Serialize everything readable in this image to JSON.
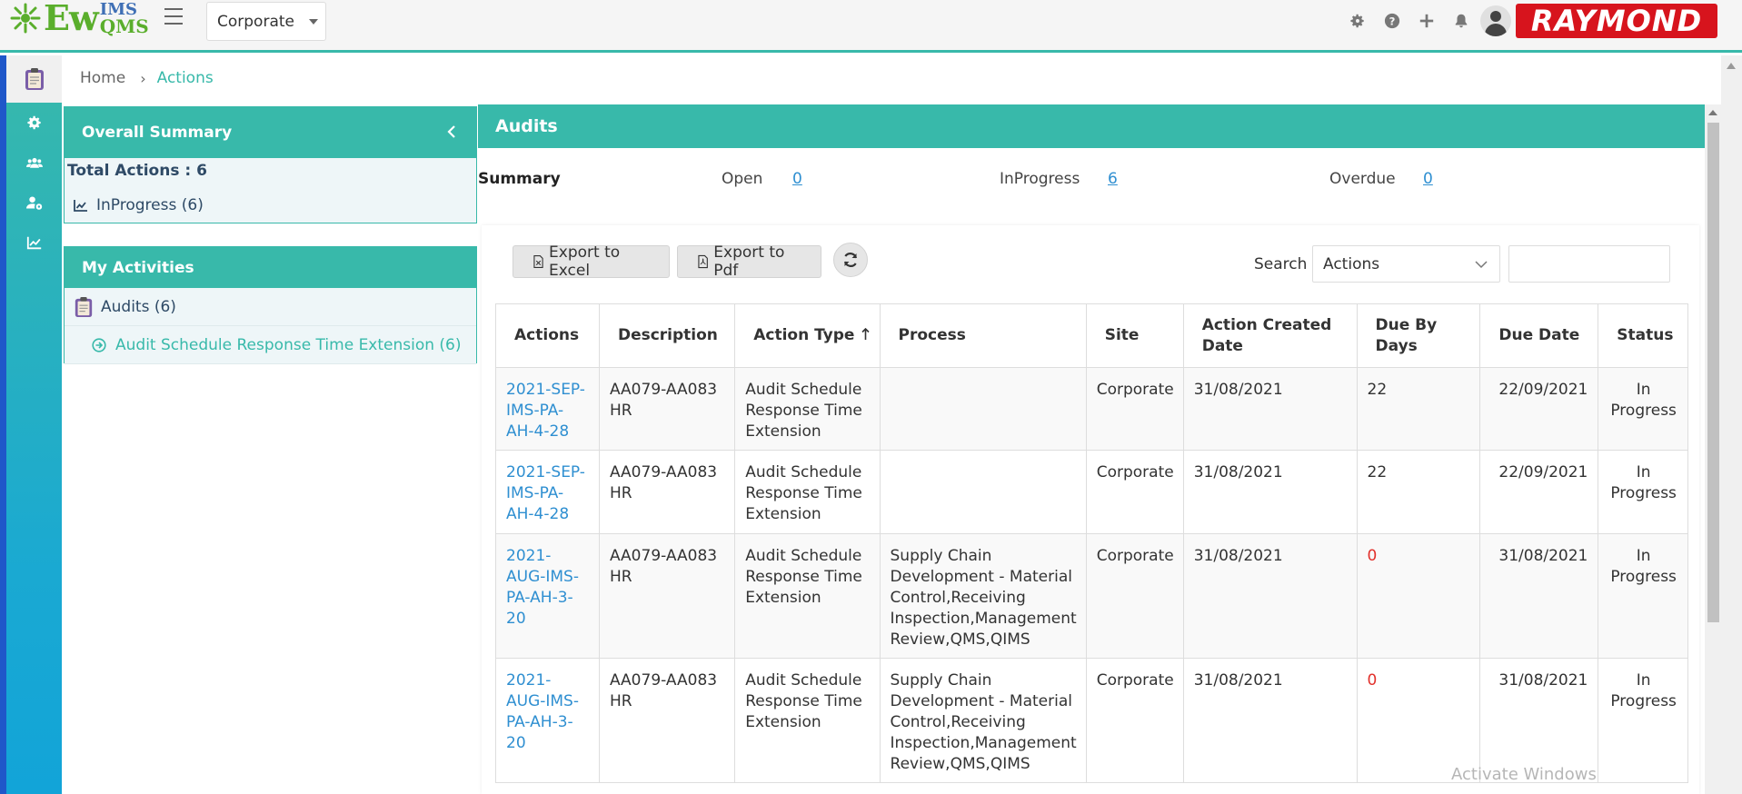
{
  "topbar": {
    "logo_ew": "Ew",
    "logo_ims": "IMS",
    "logo_qms": "QMS",
    "site_selected": "Corporate",
    "brand": "RAYMOND"
  },
  "breadcrumb": {
    "home": "Home",
    "current": "Actions"
  },
  "overall_summary": {
    "title": "Overall Summary",
    "total_actions": "Total Actions : 6",
    "inprogress": "InProgress (6)"
  },
  "my_activities": {
    "title": "My Activities",
    "audits": "Audits (6)",
    "sub_item": "Audit Schedule Response Time Extension (6)"
  },
  "main": {
    "title": "Audits",
    "summary_label": "Summary",
    "open_label": "Open",
    "open_value": "0",
    "inprogress_label": "InProgress",
    "inprogress_value": "6",
    "overdue_label": "Overdue",
    "overdue_value": "0"
  },
  "toolbar": {
    "export_excel": "Export to Excel",
    "export_pdf": "Export to Pdf",
    "search_label": "Search",
    "search_field": "Actions"
  },
  "table": {
    "headers": {
      "actions": "Actions",
      "description": "Description",
      "action_type": "Action Type",
      "process": "Process",
      "site": "Site",
      "created": "Action Created Date",
      "due_by": "Due By Days",
      "due_date": "Due Date",
      "status": "Status"
    },
    "rows": [
      {
        "action": "2021-SEP-IMS-PA-AH-4-28",
        "description": "AA079-AA083 HR",
        "action_type": "Audit Schedule Response Time Extension",
        "process": "",
        "site": "Corporate",
        "created": "31/08/2021",
        "due_by": "22",
        "due_date": "22/09/2021",
        "status": "In Progress"
      },
      {
        "action": "2021-SEP-IMS-PA-AH-4-28",
        "description": "AA079-AA083 HR",
        "action_type": "Audit Schedule Response Time Extension",
        "process": "",
        "site": "Corporate",
        "created": "31/08/2021",
        "due_by": "22",
        "due_date": "22/09/2021",
        "status": "In Progress"
      },
      {
        "action": "2021-AUG-IMS-PA-AH-3-20",
        "description": "AA079-AA083 HR",
        "action_type": "Audit Schedule Response Time Extension",
        "process": "Supply Chain Development - Material Control,Receiving Inspection,Management Review,QMS,QIMS",
        "site": "Corporate",
        "created": "31/08/2021",
        "due_by": "0",
        "due_date": "31/08/2021",
        "status": "In Progress"
      },
      {
        "action": "2021-AUG-IMS-PA-AH-3-20",
        "description": "AA079-AA083 HR",
        "action_type": "Audit Schedule Response Time Extension",
        "process": "Supply Chain Development - Material Control,Receiving Inspection,Management Review,QMS,QIMS",
        "site": "Corporate",
        "created": "31/08/2021",
        "due_by": "0",
        "due_date": "31/08/2021",
        "status": "In Progress"
      }
    ]
  },
  "watermark": "Activate Windows",
  "colors": {
    "teal": "#38b9aa",
    "link": "#2f8fd1",
    "red": "#e2312c",
    "brand_red": "#d7141d"
  }
}
